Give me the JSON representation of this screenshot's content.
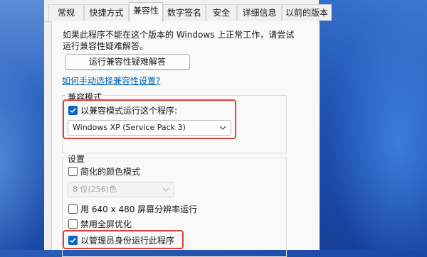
{
  "tabs": [
    {
      "label": "常规"
    },
    {
      "label": "快捷方式"
    },
    {
      "label": "兼容性"
    },
    {
      "label": "数字签名"
    },
    {
      "label": "安全"
    },
    {
      "label": "详细信息"
    },
    {
      "label": "以前的版本"
    }
  ],
  "active_tab": "兼容性",
  "description_line1": "如果此程序不能在这个版本的 Windows 上正常工作，请尝试",
  "description_line2": "运行兼容性疑难解答。",
  "troubleshoot_button": "运行兼容性疑难解答",
  "manual_link": "如何手动选择兼容性设置?",
  "compat_mode": {
    "group_title": "兼容模式",
    "checkbox_label": "以兼容模式运行这个程序:",
    "checked": true,
    "selected_os": "Windows XP (Service Pack 3)"
  },
  "settings": {
    "group_title": "设置",
    "reduced_color_label": "简化的颜色模式",
    "reduced_color_checked": false,
    "color_select": "8 位(256)色",
    "resolution_label": "用 640 x 480 屏幕分辨率运行",
    "resolution_checked": false,
    "fullscreen_label": "禁用全屏优化",
    "fullscreen_checked": false,
    "admin_label": "以管理员身份运行此程序",
    "admin_checked": true
  },
  "colors": {
    "accent": "#0a64c8",
    "highlight": "#e0413b",
    "link": "#0060b0"
  }
}
